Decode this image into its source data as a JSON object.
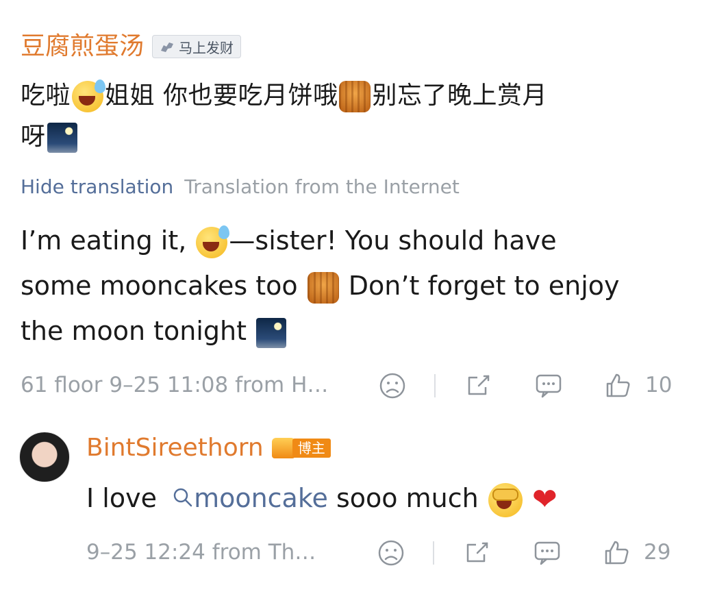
{
  "comment1": {
    "username": "豆腐煎蛋汤",
    "badge_label": "马上发财",
    "badge_icon": "horse-icon",
    "text_parts": [
      "吃啦",
      "姐姐 你也要吃月饼哦",
      "别忘了晚上赏月",
      "呀"
    ],
    "translation_toggle": "Hide translation",
    "translation_source": "Translation from the Internet",
    "translation_parts": [
      "I’m eating it,",
      "—sister! You should have",
      "some mooncakes too",
      "Don’t forget to enjoy",
      "the moon tonight"
    ],
    "meta": "61 floor 9–25 11:08  from H…",
    "like_count": "10"
  },
  "comment2": {
    "username": "BintSireethorn",
    "badge_label": "博主",
    "text_prefix": "I love",
    "topic_link": "mooncake",
    "text_suffix": "sooo much",
    "meta": "9–25 12:24  from Th…",
    "like_count": "29"
  },
  "colors": {
    "username": "#e07a2e",
    "link": "#546e99",
    "muted": "#9aa0a6",
    "heart": "#e0242a"
  }
}
